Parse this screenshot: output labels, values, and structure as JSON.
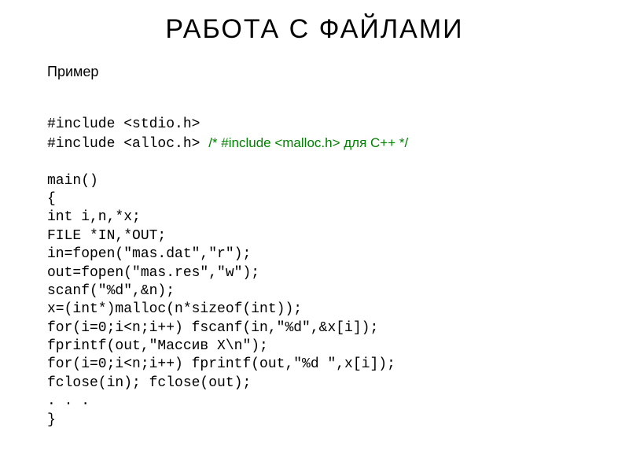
{
  "title": "РАБОТА  С  ФАЙЛАМИ",
  "subtitle": "Пример",
  "code": {
    "l1": "#include <stdio.h>",
    "l2": "#include <alloc.h> ",
    "l2_comment": "/* #include <malloc.h> для С++ */",
    "l3": "",
    "l4": "main()",
    "l5": "{",
    "l6": "int i,n,*x;",
    "l7": "FILE *in,*out;",
    "l8": "in=fopen(\"mas.dat\",\"r\");",
    "l9": "out=fopen(\"mas.res\",\"w\");",
    "l10": "scanf(\"%d\",&n);",
    "l11": "x=(int*)malloc(n*sizeof(int));",
    "l12": "for(i=0;i<n;i++) fscanf(in,\"%d\",&x[i]);",
    "l13": "fprintf(out,\"Массив X\\n\");",
    "l14": "for(i=0;i<n;i++) fprintf(out,\"%d \",x[i]);",
    "l15": "fclose(in); fclose(out);",
    "l16": ". . .",
    "l17": "}"
  }
}
